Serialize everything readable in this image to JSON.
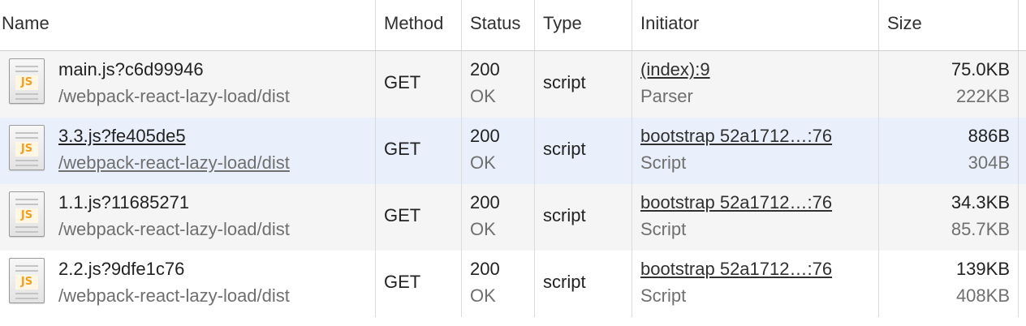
{
  "columns": {
    "name": "Name",
    "method": "Method",
    "status": "Status",
    "type": "Type",
    "initiator": "Initiator",
    "size": "Size"
  },
  "icon": {
    "semantic": "js-file-icon",
    "badge_text": "JS",
    "accent": "#f0a020"
  },
  "selected_row_color": "#eaf0fb",
  "requests": [
    {
      "name": "main.js?c6d99946",
      "path": "/webpack-react-lazy-load/dist",
      "method": "GET",
      "status_code": "200",
      "status_text": "OK",
      "type": "script",
      "initiator": "(index):9",
      "initiator_type": "Parser",
      "size_transferred": "75.0KB",
      "size_resource": "222KB"
    },
    {
      "name": "3.3.js?fe405de5",
      "path": "/webpack-react-lazy-load/dist",
      "method": "GET",
      "status_code": "200",
      "status_text": "OK",
      "type": "script",
      "initiator": "bootstrap 52a1712…:76",
      "initiator_type": "Script",
      "size_transferred": "886B",
      "size_resource": "304B"
    },
    {
      "name": "1.1.js?11685271",
      "path": "/webpack-react-lazy-load/dist",
      "method": "GET",
      "status_code": "200",
      "status_text": "OK",
      "type": "script",
      "initiator": "bootstrap 52a1712…:76",
      "initiator_type": "Script",
      "size_transferred": "34.3KB",
      "size_resource": "85.7KB"
    },
    {
      "name": "2.2.js?9dfe1c76",
      "path": "/webpack-react-lazy-load/dist",
      "method": "GET",
      "status_code": "200",
      "status_text": "OK",
      "type": "script",
      "initiator": "bootstrap 52a1712…:76",
      "initiator_type": "Script",
      "size_transferred": "139KB",
      "size_resource": "408KB"
    }
  ]
}
